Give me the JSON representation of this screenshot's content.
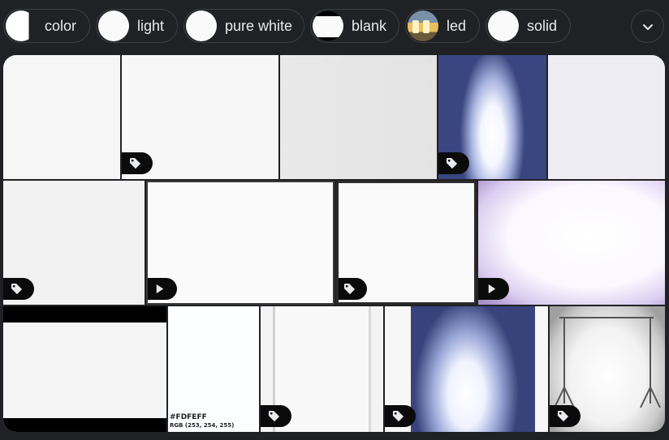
{
  "chips": [
    {
      "label": "color",
      "thumb": "color"
    },
    {
      "label": "light",
      "thumb": "white"
    },
    {
      "label": "pure white",
      "thumb": "white"
    },
    {
      "label": "blank",
      "thumb": "blank"
    },
    {
      "label": "led",
      "thumb": "led"
    },
    {
      "label": "solid",
      "thumb": "white"
    }
  ],
  "expand_icon": "chevron-down-icon",
  "results": [
    {
      "name": "white-image-1",
      "badge": "none"
    },
    {
      "name": "white-image-2",
      "badge": "tag-icon"
    },
    {
      "name": "white-image-3",
      "badge": "none"
    },
    {
      "name": "led-light-image",
      "badge": "tag-icon"
    },
    {
      "name": "white-image-5",
      "badge": "none"
    },
    {
      "name": "white-texture-image",
      "badge": "tag-icon"
    },
    {
      "name": "white-screen-image",
      "badge": "play-icon"
    },
    {
      "name": "white-framed-image",
      "badge": "tag-icon"
    },
    {
      "name": "white-purple-glow-image",
      "badge": "play-icon"
    },
    {
      "name": "white-letterbox-image",
      "badge": "none"
    },
    {
      "name": "white-swatch-image",
      "badge": "none",
      "swatch_hex": "#FDFEFF",
      "swatch_rgb": "RGB (253, 254, 255)"
    },
    {
      "name": "white-panel-image",
      "badge": "tag-icon"
    },
    {
      "name": "led-light-image-2",
      "badge": "tag-icon"
    },
    {
      "name": "photo-backdrop-image",
      "badge": "tag-icon"
    }
  ]
}
